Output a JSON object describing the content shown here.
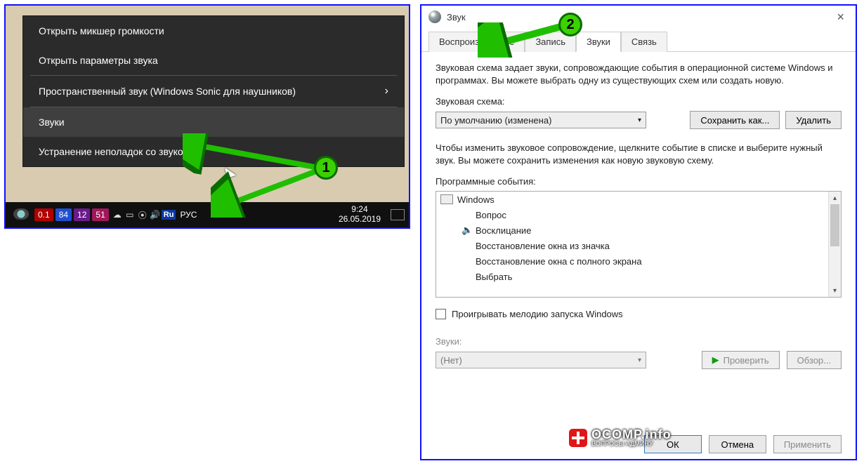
{
  "context_menu": {
    "items": [
      {
        "label": "Открыть микшер громкости",
        "hover": false,
        "has_sub": false
      },
      {
        "label": "Открыть параметры звука",
        "hover": false,
        "has_sub": false
      },
      {
        "label": "Пространственный звук (Windows Sonic для наушников)",
        "hover": false,
        "has_sub": true
      },
      {
        "label": "Звуки",
        "hover": true,
        "has_sub": false
      },
      {
        "label": "Устранение неполадок со звуком",
        "hover": false,
        "has_sub": false
      }
    ]
  },
  "taskbar": {
    "blocks": {
      "red": "0.1",
      "blue": "84",
      "purple": "12",
      "pink": "51"
    },
    "lang_indicator": "Ru",
    "lang_text": "РУС",
    "time": "9:24",
    "date": "26.05.2019"
  },
  "dialog": {
    "title": "Звук",
    "tabs": [
      "Воспроизведение",
      "Запись",
      "Звуки",
      "Связь"
    ],
    "active_tab_index": 2,
    "description": "Звуковая схема задает звуки, сопровождающие события в операционной системе Windows и программах. Вы можете выбрать одну из существующих схем или создать новую.",
    "scheme_label": "Звуковая схема:",
    "scheme_value": "По умолчанию (изменена)",
    "save_as_btn": "Сохранить как...",
    "delete_btn": "Удалить",
    "events_description": "Чтобы изменить звуковое сопровождение, щелкните событие в списке и выберите нужный звук. Вы можете сохранить изменения как новую звуковую схему.",
    "events_label": "Программные события:",
    "events": {
      "root": "Windows",
      "children": [
        {
          "label": "Вопрос",
          "has_sound": false
        },
        {
          "label": "Восклицание",
          "has_sound": true
        },
        {
          "label": "Восстановление окна из значка",
          "has_sound": false
        },
        {
          "label": "Восстановление окна с полного экрана",
          "has_sound": false
        },
        {
          "label": "Выбрать",
          "has_sound": false
        }
      ]
    },
    "startup_checkbox": "Проигрывать мелодию запуска Windows",
    "startup_checked": false,
    "sounds_label": "Звуки:",
    "sounds_value": "(Нет)",
    "test_btn": "Проверить",
    "browse_btn": "Обзор...",
    "ok_btn": "ОК",
    "cancel_btn": "Отмена",
    "apply_btn": "Применить"
  },
  "watermark": {
    "main": "OCOMP.info",
    "sub": "ВОПРОСЫ АДМИНУ"
  },
  "annotations": {
    "badge1": "1",
    "badge2": "2"
  }
}
